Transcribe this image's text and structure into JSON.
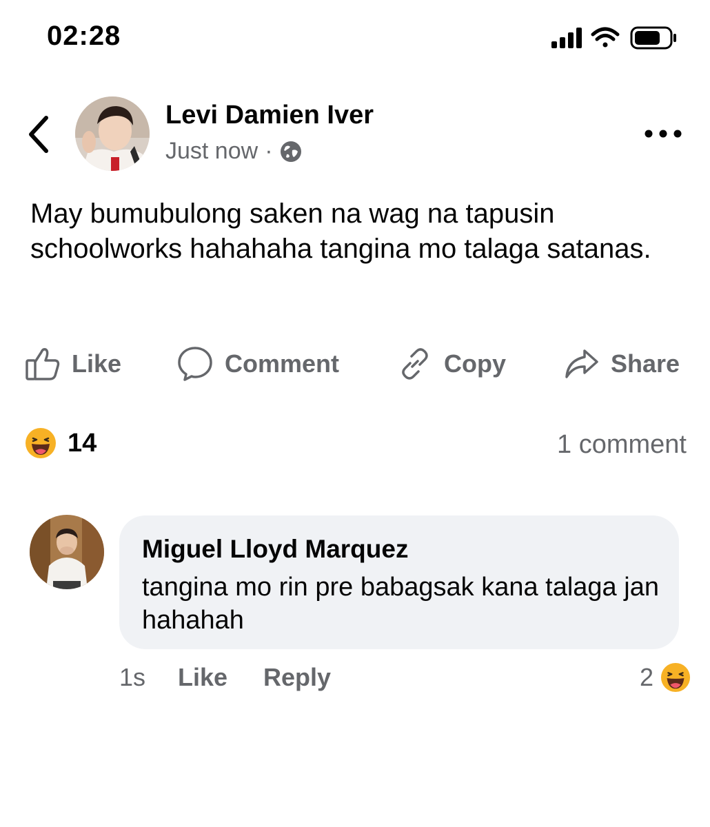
{
  "status_bar": {
    "time": "02:28",
    "icons": [
      "signal-icon",
      "wifi-icon",
      "battery-icon"
    ]
  },
  "post": {
    "author": "Levi Damien Iver",
    "timestamp": "Just now",
    "separator": "·",
    "audience_icon": "globe-icon",
    "text": "May bumubulong saken na wag na tapusin schoolworks hahahaha tangina mo talaga satanas."
  },
  "actions": {
    "like": "Like",
    "comment": "Comment",
    "copy": "Copy",
    "share": "Share"
  },
  "reactions": {
    "emoji": "haha-emoji-icon",
    "count": "14",
    "comments_label": "1 comment"
  },
  "comment": {
    "author": "Miguel Lloyd Marquez",
    "text": "tangina mo rin pre babagsak kana talaga jan hahahah",
    "time": "1s",
    "like": "Like",
    "reply": "Reply",
    "reaction_count": "2"
  },
  "colors": {
    "text_primary": "#050505",
    "text_secondary": "#65676b",
    "bubble": "#f0f2f5",
    "haha": "#f7b125"
  }
}
